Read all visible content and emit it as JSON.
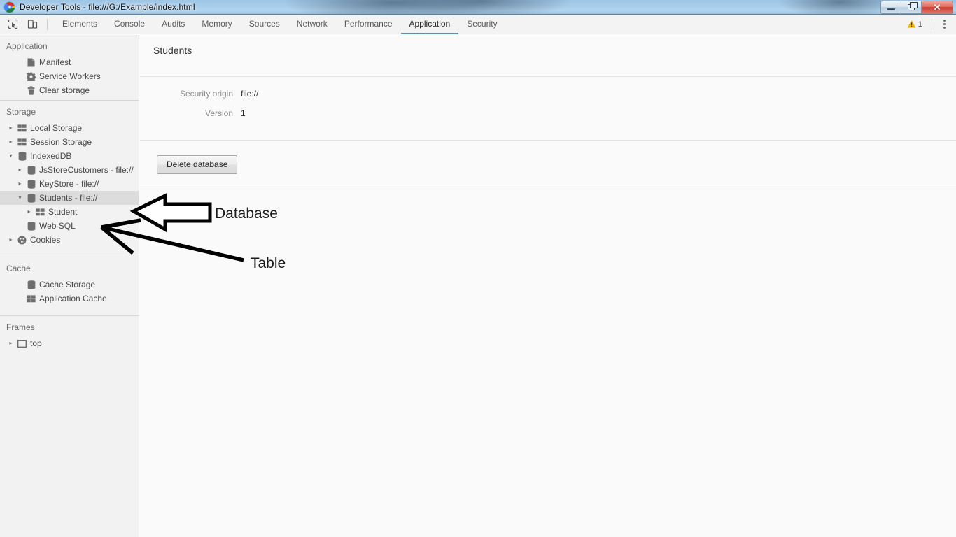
{
  "window": {
    "title": "Developer Tools - file:///G:/Example/index.html",
    "app_icon": "chrome-logo-icon",
    "controls": {
      "minimize": "–",
      "restore": "❐",
      "close": "✕"
    }
  },
  "toolbar": {
    "inspect_icon": "inspect-element-icon",
    "device_icon": "device-toolbar-icon",
    "tabs": [
      {
        "label": "Elements",
        "active": false
      },
      {
        "label": "Console",
        "active": false
      },
      {
        "label": "Audits",
        "active": false
      },
      {
        "label": "Memory",
        "active": false
      },
      {
        "label": "Sources",
        "active": false
      },
      {
        "label": "Network",
        "active": false
      },
      {
        "label": "Performance",
        "active": false
      },
      {
        "label": "Application",
        "active": true
      },
      {
        "label": "Security",
        "active": false
      }
    ],
    "warning": {
      "icon": "warning-triangle-icon",
      "count": "1",
      "color": "#f2b705"
    },
    "menu_icon": "more-options-kebab-icon"
  },
  "sidebar": {
    "sections": [
      {
        "title": "Application",
        "items": [
          {
            "label": "Manifest",
            "icon": "document-icon",
            "indent": 1,
            "twisty": "none",
            "selected": false
          },
          {
            "label": "Service Workers",
            "icon": "gear-icon",
            "indent": 1,
            "twisty": "none",
            "selected": false
          },
          {
            "label": "Clear storage",
            "icon": "trash-icon",
            "indent": 1,
            "twisty": "none",
            "selected": false
          }
        ]
      },
      {
        "title": "Storage",
        "items": [
          {
            "label": "Local Storage",
            "icon": "table-grid-icon",
            "indent": 0,
            "twisty": "collapsed",
            "selected": false
          },
          {
            "label": "Session Storage",
            "icon": "table-grid-icon",
            "indent": 0,
            "twisty": "collapsed",
            "selected": false
          },
          {
            "label": "IndexedDB",
            "icon": "database-icon",
            "indent": 0,
            "twisty": "expanded",
            "selected": false
          },
          {
            "label": "JsStoreCustomers - file://",
            "icon": "database-icon",
            "indent": 1,
            "twisty": "collapsed",
            "selected": false
          },
          {
            "label": "KeyStore - file://",
            "icon": "database-icon",
            "indent": 1,
            "twisty": "collapsed",
            "selected": false
          },
          {
            "label": "Students - file://",
            "icon": "database-icon",
            "indent": 1,
            "twisty": "expanded",
            "selected": true
          },
          {
            "label": "Student",
            "icon": "table-grid-icon",
            "indent": 2,
            "twisty": "collapsed",
            "selected": false
          },
          {
            "label": "Web SQL",
            "icon": "database-icon",
            "indent": 1,
            "twisty": "none",
            "selected": false
          },
          {
            "label": "Cookies",
            "icon": "cookie-icon",
            "indent": 0,
            "twisty": "collapsed",
            "selected": false
          }
        ]
      },
      {
        "title": "Cache",
        "items": [
          {
            "label": "Cache Storage",
            "icon": "database-icon",
            "indent": 1,
            "twisty": "none",
            "selected": false
          },
          {
            "label": "Application Cache",
            "icon": "table-grid-icon",
            "indent": 1,
            "twisty": "none",
            "selected": false
          }
        ]
      },
      {
        "title": "Frames",
        "items": [
          {
            "label": "top",
            "icon": "frame-icon",
            "indent": 0,
            "twisty": "collapsed",
            "selected": false
          }
        ]
      }
    ]
  },
  "main": {
    "title": "Students",
    "metrics": [
      {
        "key": "Security origin",
        "value": "file://"
      },
      {
        "key": "Version",
        "value": "1"
      }
    ],
    "delete_button": "Delete database"
  },
  "annotations": [
    {
      "label": "Database",
      "shape": "block-arrow-left",
      "points_to": "Students - file://"
    },
    {
      "label": "Table",
      "shape": "line-arrow-left",
      "points_to": "Student"
    }
  ]
}
